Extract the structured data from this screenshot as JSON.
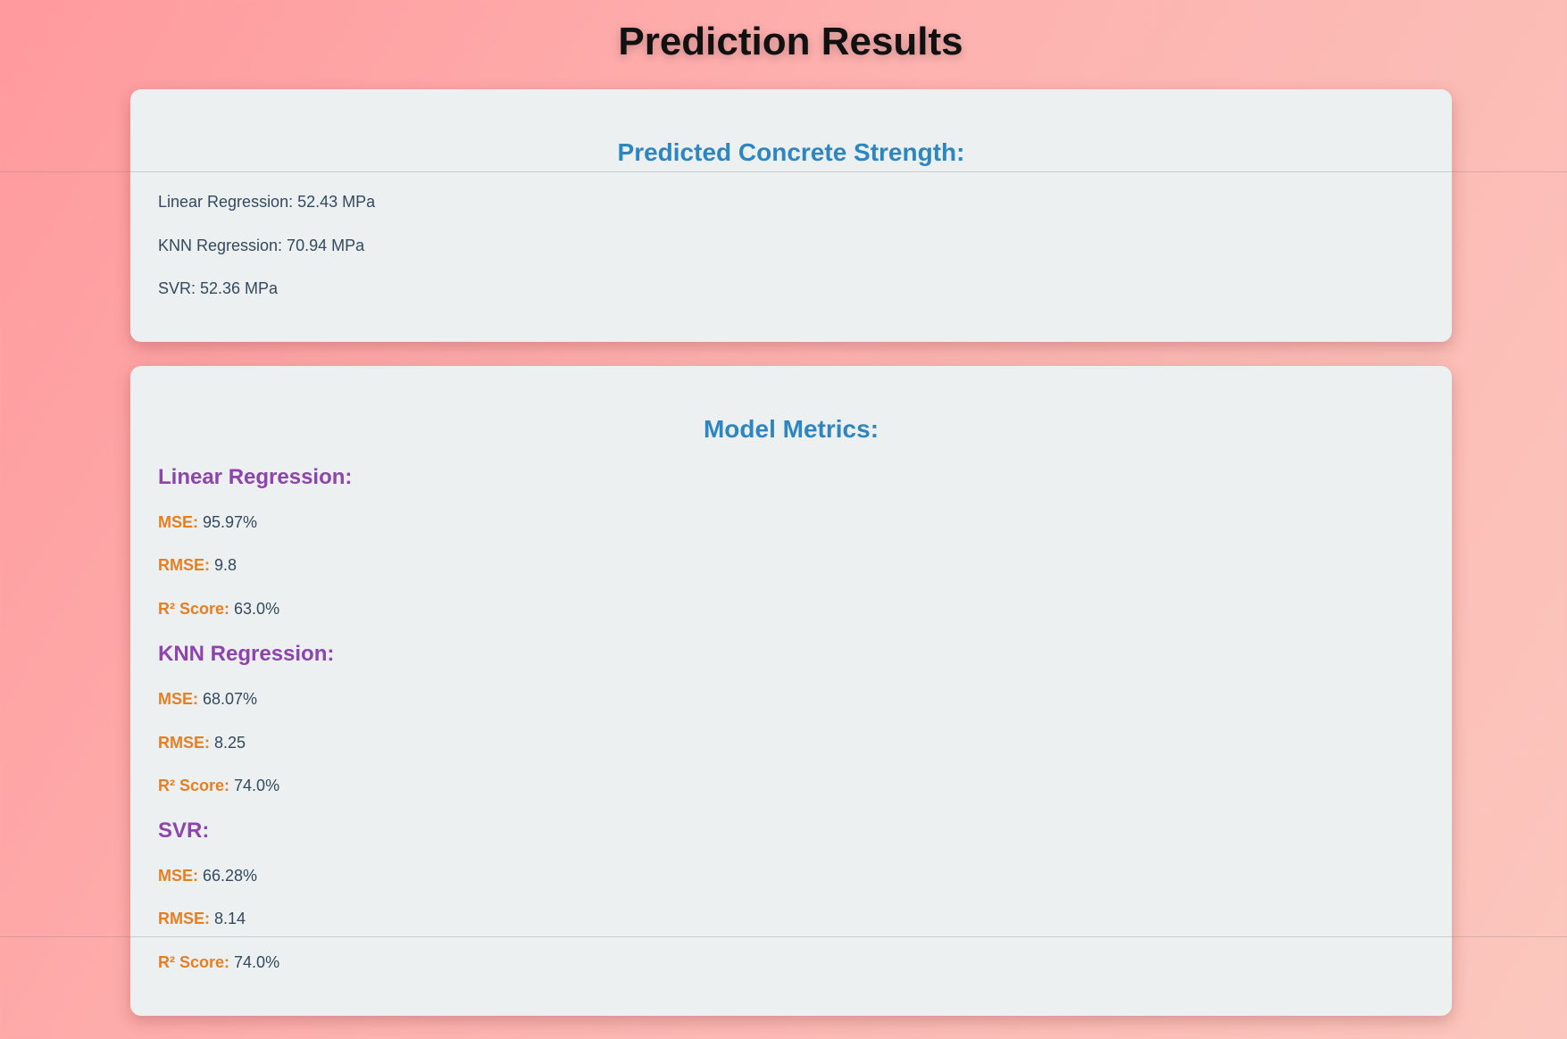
{
  "page": {
    "title": "Prediction Results"
  },
  "predictions": {
    "title": "Predicted Concrete Strength:",
    "items": [
      {
        "text": "Linear Regression: 52.43 MPa"
      },
      {
        "text": "KNN Regression: 70.94 MPa"
      },
      {
        "text": "SVR: 52.36 MPa"
      }
    ]
  },
  "metrics": {
    "title": "Model Metrics:",
    "models": [
      {
        "name": "Linear Regression:",
        "mse_label": "MSE:",
        "mse": "95.97%",
        "rmse_label": "RMSE:",
        "rmse": "9.8",
        "r2_label": "R² Score:",
        "r2": "63.0%"
      },
      {
        "name": "KNN Regression:",
        "mse_label": "MSE:",
        "mse": "68.07%",
        "rmse_label": "RMSE:",
        "rmse": "8.25",
        "r2_label": "R² Score:",
        "r2": "74.0%"
      },
      {
        "name": "SVR:",
        "mse_label": "MSE:",
        "mse": "66.28%",
        "rmse_label": "RMSE:",
        "rmse": "8.14",
        "r2_label": "R² Score:",
        "r2": "74.0%"
      }
    ]
  },
  "colors": {
    "card_title": "#2e86c1",
    "model_heading": "#8e44ad",
    "metric_label": "#e67e22",
    "body_text": "#34495e",
    "card_background": "#ecf0f1"
  }
}
